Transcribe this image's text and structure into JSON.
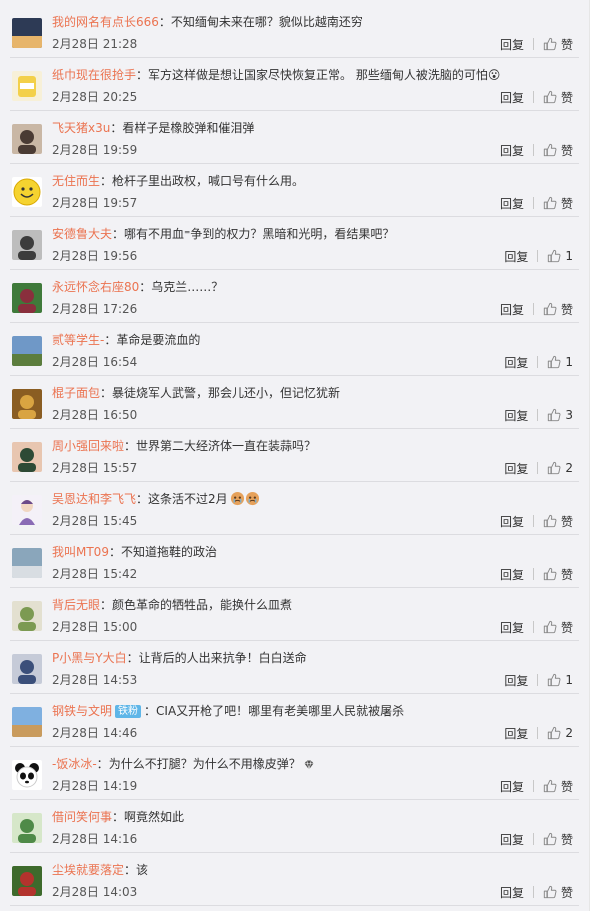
{
  "comments": [
    {
      "user": "我的网名有点长666",
      "text": "不知缅甸未来在哪？貌似比越南还穷",
      "time": "2月28日 21:28",
      "reply": "回复",
      "likes": "赞",
      "avatar": "avatar-sunset",
      "avatar_colors": [
        "#2d3a55",
        "#e7b56b"
      ],
      "badge": "",
      "emoji": ""
    },
    {
      "user": "纸巾现在很抢手",
      "text": "军方这样做是想让国家尽快恢复正常。 那些缅甸人被洗脑的可怕😮",
      "time": "2月28日 20:25",
      "reply": "回复",
      "likes": "赞",
      "avatar": "avatar-yellow-can",
      "avatar_colors": [
        "#f3d04a",
        "#ffffff"
      ],
      "badge": "",
      "emoji": ""
    },
    {
      "user": "飞天猪x3u",
      "text": "看样子是橡胶弹和催泪弹",
      "time": "2月28日 19:59",
      "reply": "回复",
      "likes": "赞",
      "avatar": "avatar-portrait",
      "avatar_colors": [
        "#4a3b34",
        "#c9b7a5"
      ],
      "badge": "",
      "emoji": ""
    },
    {
      "user": "无住而生",
      "text": "枪杆子里出政权，喊口号有什么用。",
      "time": "2月28日 19:57",
      "reply": "回复",
      "likes": "赞",
      "avatar": "avatar-smiley",
      "avatar_colors": [
        "#f5d330",
        "#ffffff"
      ],
      "badge": "",
      "emoji": ""
    },
    {
      "user": "安德鲁大夫",
      "text": "哪有不用血⁼争到的权力？黑暗和光明，看结果吧？",
      "time": "2月28日 19:56",
      "reply": "回复",
      "likes": "1",
      "avatar": "avatar-bw-portrait",
      "avatar_colors": [
        "#3c3c3c",
        "#bdbdbd"
      ],
      "badge": "",
      "emoji": ""
    },
    {
      "user": "永远怀念右座80",
      "text": "乌克兰……？",
      "time": "2月28日 17:26",
      "reply": "回复",
      "likes": "赞",
      "avatar": "avatar-flower",
      "avatar_colors": [
        "#8a2f3d",
        "#3f7a3a"
      ],
      "badge": "",
      "emoji": ""
    },
    {
      "user": "贰等学生-",
      "text": "革命是要流血的",
      "time": "2月28日 16:54",
      "reply": "回复",
      "likes": "1",
      "avatar": "avatar-landscape",
      "avatar_colors": [
        "#6f98c7",
        "#5c7d3d"
      ],
      "badge": "",
      "emoji": ""
    },
    {
      "user": "棍子面包",
      "text": "暴徒烧军人武警，那会儿还小，但记忆犹新",
      "time": "2月28日 16:50",
      "reply": "回复",
      "likes": "3",
      "avatar": "avatar-cat",
      "avatar_colors": [
        "#d9a441",
        "#8a5d22"
      ],
      "badge": "",
      "emoji": ""
    },
    {
      "user": "周小强回来啦",
      "text": "世界第二大经济体一直在装蒜吗？",
      "time": "2月28日 15:57",
      "reply": "回复",
      "likes": "2",
      "avatar": "avatar-girl",
      "avatar_colors": [
        "#2d4a35",
        "#e8c6b0"
      ],
      "badge": "",
      "emoji": ""
    },
    {
      "user": "吴恩达和李飞飞",
      "text": "这条活不过2月",
      "time": "2月28日 15:45",
      "reply": "回复",
      "likes": "赞",
      "avatar": "avatar-cartoon",
      "avatar_colors": [
        "#f4f1f8",
        "#8a6bb5"
      ],
      "badge": "",
      "emoji": "crying-face-icon"
    },
    {
      "user": "我叫MT09",
      "text": "不知道拖鞋的政治",
      "time": "2月28日 15:42",
      "reply": "回复",
      "likes": "赞",
      "avatar": "avatar-car",
      "avatar_colors": [
        "#8aa6bb",
        "#d8dde2"
      ],
      "badge": "",
      "emoji": ""
    },
    {
      "user": "背后无眼",
      "text": "颜色革命的牺牲品，能换什么皿煮",
      "time": "2月28日 15:00",
      "reply": "回复",
      "likes": "赞",
      "avatar": "avatar-dogs",
      "avatar_colors": [
        "#7c9a52",
        "#e3e0d0"
      ],
      "badge": "",
      "emoji": ""
    },
    {
      "user": "P小黑与Y大白",
      "text": "让背后的人出来抗争！白白送命",
      "time": "2月28日 14:53",
      "reply": "回复",
      "likes": "1",
      "avatar": "avatar-person-blue",
      "avatar_colors": [
        "#3b4f7a",
        "#c6cbd8"
      ],
      "badge": "",
      "emoji": ""
    },
    {
      "user": "钢铁与文明",
      "text": "CIA又开枪了吧！哪里有老美哪里人民就被屠杀",
      "time": "2月28日 14:46",
      "reply": "回复",
      "likes": "2",
      "avatar": "avatar-sky",
      "avatar_colors": [
        "#7fb0e0",
        "#c99b5d"
      ],
      "badge": "铁粉",
      "emoji": ""
    },
    {
      "user": "-饭冰冰-",
      "text": "为什么不打腿？为什么不用橡皮弹？",
      "time": "2月28日 14:19",
      "reply": "回复",
      "likes": "赞",
      "avatar": "avatar-panda",
      "avatar_colors": [
        "#111111",
        "#ffffff"
      ],
      "badge": "",
      "emoji": "diamond-icon"
    },
    {
      "user": "借问笑何事",
      "text": "啊竟然如此",
      "time": "2月28日 14:16",
      "reply": "回复",
      "likes": "赞",
      "avatar": "avatar-green-figure",
      "avatar_colors": [
        "#4f8a48",
        "#d6e7c9"
      ],
      "badge": "",
      "emoji": ""
    },
    {
      "user": "尘埃就要落定",
      "text": "该",
      "time": "2月28日 14:03",
      "reply": "回复",
      "likes": "赞",
      "avatar": "avatar-red-flowers",
      "avatar_colors": [
        "#b3332d",
        "#3e6a2c"
      ],
      "badge": "",
      "emoji": ""
    }
  ]
}
